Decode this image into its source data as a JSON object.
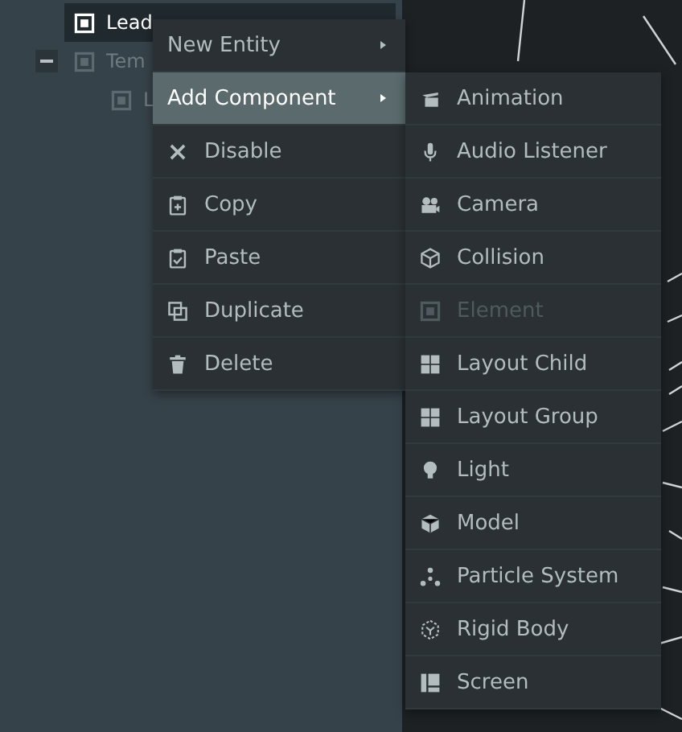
{
  "hierarchy": [
    {
      "label": "Lead",
      "selected": true,
      "enabled": true
    },
    {
      "label": "Tem",
      "selected": false,
      "enabled": false,
      "expanded": true,
      "children": [
        {
          "label": "L",
          "selected": false,
          "enabled": false
        }
      ]
    }
  ],
  "context_menu": [
    {
      "label": "New Entity",
      "selected": false,
      "submenu": true
    },
    {
      "label": "Add Component",
      "selected": true,
      "submenu": true
    },
    {
      "label": "Disable",
      "selected": false,
      "submenu": false
    },
    {
      "label": "Copy",
      "selected": false,
      "submenu": false
    },
    {
      "label": "Paste",
      "selected": false,
      "submenu": false
    },
    {
      "label": "Duplicate",
      "selected": false,
      "submenu": false
    },
    {
      "label": "Delete",
      "selected": false,
      "submenu": false
    }
  ],
  "submenu": [
    {
      "label": "Animation",
      "disabled": false
    },
    {
      "label": "Audio Listener",
      "disabled": false
    },
    {
      "label": "Camera",
      "disabled": false
    },
    {
      "label": "Collision",
      "disabled": false
    },
    {
      "label": "Element",
      "disabled": true
    },
    {
      "label": "Layout Child",
      "disabled": false
    },
    {
      "label": "Layout Group",
      "disabled": false
    },
    {
      "label": "Light",
      "disabled": false
    },
    {
      "label": "Model",
      "disabled": false
    },
    {
      "label": "Particle System",
      "disabled": false
    },
    {
      "label": "Rigid Body",
      "disabled": false
    },
    {
      "label": "Screen",
      "disabled": false
    }
  ]
}
